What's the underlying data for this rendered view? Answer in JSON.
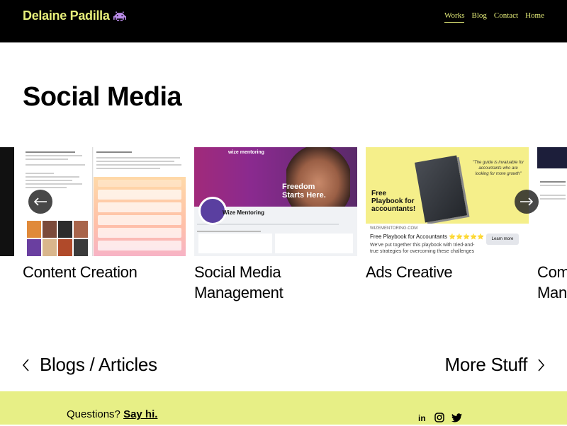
{
  "header": {
    "logo_text": "Delaine Padilla",
    "logo_icon": "space-invader-icon",
    "nav": [
      {
        "label": "Works",
        "active": true
      },
      {
        "label": "Blog",
        "active": false
      },
      {
        "label": "Contact",
        "active": false
      },
      {
        "label": "Home",
        "active": false
      }
    ]
  },
  "main": {
    "title": "Social Media",
    "carousel": {
      "cards": [
        {
          "label": "Content Creation"
        },
        {
          "label": "Social Media Management"
        },
        {
          "label": "Ads Creative"
        },
        {
          "label": "Com Man"
        }
      ],
      "thumbs": {
        "smm_brand": "wize mentoring",
        "smm_slogan_1": "Freedom",
        "smm_slogan_2": "Starts Here.",
        "smm_page_name": "Wize Mentoring",
        "ads_free_1": "Free",
        "ads_free_2": "Playbook for",
        "ads_free_3": "accountants!",
        "ads_quote": "\"The guide is invaluable for accountants who are looking for more growth\"",
        "ads_domain": "WIZEMENTORING.COM",
        "ads_headline": "Free Playbook for Accountants ⭐⭐⭐⭐⭐",
        "ads_body": "We've put together this playbook with tried-and-true strategies for overcoming these challenges so your...",
        "ads_button": "Learn more"
      }
    }
  },
  "pagination": {
    "prev_label": "Blogs / Articles",
    "next_label": "More Stuff"
  },
  "footer": {
    "questions_text": "Questions?",
    "say_hi": "Say hi.",
    "social_icons": [
      "linkedin-icon",
      "instagram-icon",
      "twitter-icon"
    ]
  },
  "colors": {
    "accent": "#e6ee7a",
    "header_bg": "#000000",
    "footer_bg": "#e7ef86"
  }
}
